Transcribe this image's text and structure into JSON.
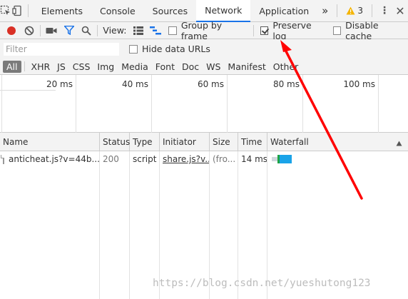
{
  "tabs": [
    {
      "label": "Elements",
      "active": false
    },
    {
      "label": "Console",
      "active": false
    },
    {
      "label": "Sources",
      "active": false
    },
    {
      "label": "Network",
      "active": true
    },
    {
      "label": "Application",
      "active": false
    }
  ],
  "tab_overflow": "»",
  "warnings": {
    "count": "3"
  },
  "toolbar": {
    "view_label": "View:",
    "group_by_frame": {
      "label": "Group by frame",
      "checked": false
    },
    "preserve_log": {
      "label": "Preserve log",
      "checked": true
    },
    "disable_cache": {
      "label": "Disable cache",
      "checked": false
    }
  },
  "filter": {
    "placeholder": "Filter",
    "hide_data_urls": {
      "label": "Hide data URLs",
      "checked": false
    }
  },
  "types": [
    "All",
    "XHR",
    "JS",
    "CSS",
    "Img",
    "Media",
    "Font",
    "Doc",
    "WS",
    "Manifest",
    "Other"
  ],
  "timeline": {
    "labels": [
      "20 ms",
      "40 ms",
      "60 ms",
      "80 ms",
      "100 ms"
    ]
  },
  "table": {
    "headers": {
      "name": "Name",
      "status": "Status",
      "type": "Type",
      "initiator": "Initiator",
      "size": "Size",
      "time": "Time",
      "waterfall": "Waterfall"
    },
    "rows": [
      {
        "name": "anticheat.js?v=44b...",
        "status": "200",
        "type": "script",
        "initiator": "share.js?v...",
        "size": "(fro...",
        "time": "14 ms"
      }
    ]
  },
  "watermark": "https://blog.csdn.net/yueshutong123",
  "colors": {
    "accent": "#1a73e8",
    "record": "#d93025",
    "filter_icon": "#1a73e8",
    "annotation_arrow": "#ff0000",
    "waterfall_green": "#1ea446",
    "waterfall_blue": "#1aa3e8"
  }
}
